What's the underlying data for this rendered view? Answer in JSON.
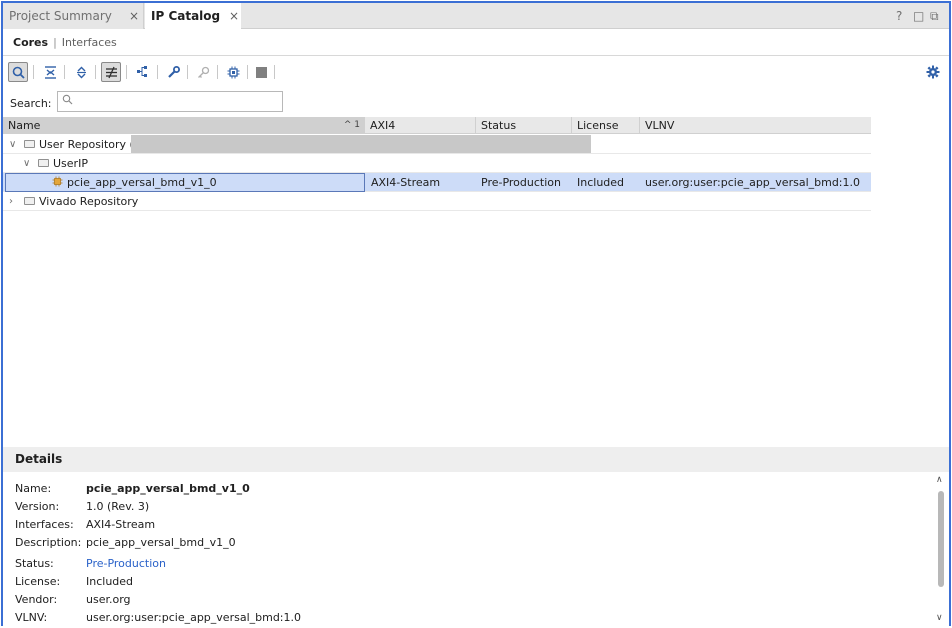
{
  "tabs": [
    {
      "label": "Project Summary",
      "active": false
    },
    {
      "label": "IP Catalog",
      "active": true
    }
  ],
  "tab_close_glyph": "×",
  "window_controls": [
    "?",
    "□",
    "⧉"
  ],
  "subtabs": {
    "selected": "Cores",
    "separator": "|",
    "other": "Interfaces"
  },
  "toolbar": {
    "icons": [
      "search-icon",
      "collapse-all-icon",
      "expand-all-icon",
      "filter-icon",
      "hierarchy-icon",
      "customize-ip-icon",
      "license-key-icon",
      "ip-settings-icon",
      "stop-icon"
    ],
    "settings_icon": "gear-icon"
  },
  "search": {
    "label": "Search:",
    "placeholder": "",
    "value": ""
  },
  "table": {
    "columns": [
      "Name",
      "AXI4",
      "Status",
      "License",
      "VLNV"
    ],
    "sort_indicator": "^ 1",
    "rows": [
      {
        "name": "User Repository (",
        "axi4": "",
        "status": "",
        "license": "",
        "vlnv": "",
        "level": 0,
        "expanded": true
      },
      {
        "name": "UserIP",
        "axi4": "",
        "status": "",
        "license": "",
        "vlnv": "",
        "level": 1,
        "expanded": true
      },
      {
        "name": "pcie_app_versal_bmd_v1_0",
        "axi4": "AXI4-Stream",
        "status": "Pre-Production",
        "license": "Included",
        "vlnv": "user.org:user:pcie_app_versal_bmd:1.0",
        "level": 2,
        "selected": true
      },
      {
        "name": "Vivado Repository",
        "axi4": "",
        "status": "",
        "license": "",
        "vlnv": "",
        "level": 0,
        "expanded": false
      }
    ]
  },
  "details": {
    "title": "Details",
    "fields": [
      {
        "label": "Name:",
        "value": "pcie_app_versal_bmd_v1_0"
      },
      {
        "label": "Version:",
        "value": "1.0 (Rev. 3)"
      },
      {
        "label": "Interfaces:",
        "value": "AXI4-Stream"
      },
      {
        "label": "Description:",
        "value": "pcie_app_versal_bmd_v1_0"
      },
      {
        "label": "Status:",
        "value": "Pre-Production"
      },
      {
        "label": "License:",
        "value": "Included"
      },
      {
        "label": "Vendor:",
        "value": "user.org"
      },
      {
        "label": "VLNV:",
        "value": "user.org:user:pcie_app_versal_bmd:1.0"
      }
    ]
  },
  "colors": {
    "accent": "#3b6fd4",
    "selection": "#cddcf8",
    "link": "#2a62c9"
  }
}
